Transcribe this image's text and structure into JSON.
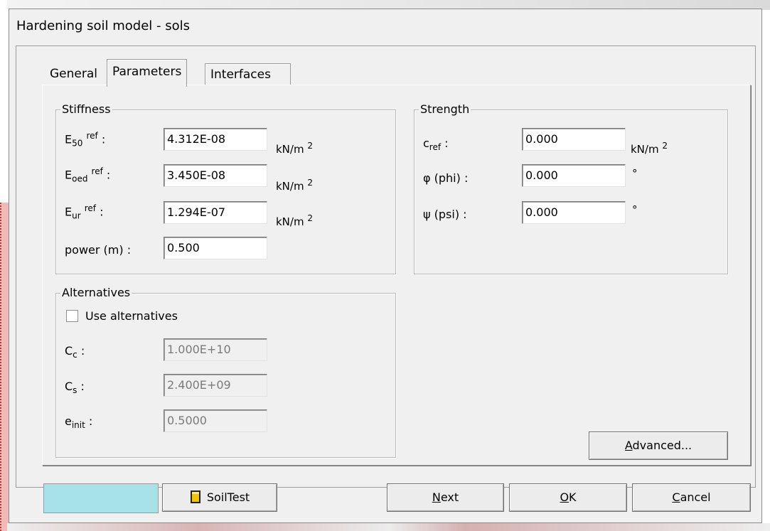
{
  "window": {
    "title": "Hardening soil model - sols"
  },
  "tabs": [
    {
      "label": "General",
      "active": false
    },
    {
      "label": "Parameters",
      "active": true
    },
    {
      "label": "Interfaces",
      "active": false
    }
  ],
  "stiffness": {
    "legend": "Stiffness",
    "e50": {
      "main": "E",
      "sub": "50",
      "sup": "ref",
      "colon": " :",
      "value": "4.312E-08",
      "unit": "kN/m",
      "unit_sup": "2"
    },
    "eoed": {
      "main": "E",
      "sub": "oed",
      "sup": "ref",
      "colon": " :",
      "value": "3.450E-08",
      "unit": "kN/m",
      "unit_sup": "2"
    },
    "eur": {
      "main": "E",
      "sub": "ur",
      "sup": "ref",
      "colon": " :",
      "value": "1.294E-07",
      "unit": "kN/m",
      "unit_sup": "2"
    },
    "power": {
      "label": "power (m) :",
      "value": "0.500"
    }
  },
  "strength": {
    "legend": "Strength",
    "cref": {
      "main": "c",
      "sub": "ref",
      "colon": " :",
      "value": "0.000",
      "unit": "kN/m",
      "unit_sup": "2"
    },
    "phi": {
      "label": "φ (phi) :",
      "value": "0.000",
      "unit": "°"
    },
    "psi": {
      "label": "ψ (psi) :",
      "value": "0.000",
      "unit": "°"
    }
  },
  "alternatives": {
    "legend": "Alternatives",
    "checkbox_label": "Use alternatives",
    "checked": false,
    "cc": {
      "main": "C",
      "sub": "c",
      "colon": " :",
      "value": "1.000E+10"
    },
    "cs": {
      "main": "C",
      "sub": "s",
      "colon": " :",
      "value": "2.400E+09"
    },
    "einit": {
      "main": "e",
      "sub": "init",
      "colon": " :",
      "value": "0.5000"
    }
  },
  "buttons": {
    "advanced": {
      "prefix": "",
      "mnemonic": "A",
      "rest": "dvanced..."
    },
    "soiltest": "SoilTest",
    "next": {
      "mnemonic": "N",
      "rest": "ext"
    },
    "ok": {
      "mnemonic": "O",
      "rest": "K"
    },
    "cancel": {
      "mnemonic": "C",
      "rest": "ancel"
    }
  },
  "colors": {
    "swatch": "#a7e2e9",
    "dialog_bg": "#f0f0f0"
  },
  "icons": {
    "soiltest": "soil-sample-icon"
  }
}
